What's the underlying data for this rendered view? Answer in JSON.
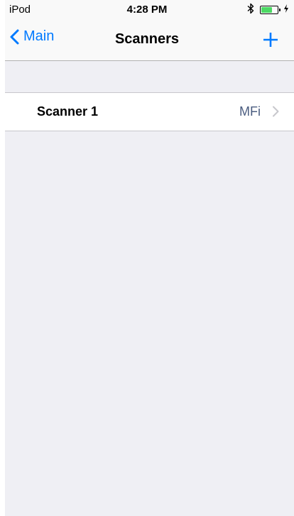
{
  "status_bar": {
    "carrier": "iPod",
    "time": "4:28 PM",
    "bluetooth_icon": "bluetooth-icon",
    "battery_icon": "battery-charging-icon",
    "battery_color": "#4cd964"
  },
  "nav": {
    "back_label": "Main",
    "title": "Scanners",
    "add_icon": "plus-icon",
    "accent": "#007aff"
  },
  "scanners": [
    {
      "name": "Scanner 1",
      "detail": "MFi"
    }
  ]
}
